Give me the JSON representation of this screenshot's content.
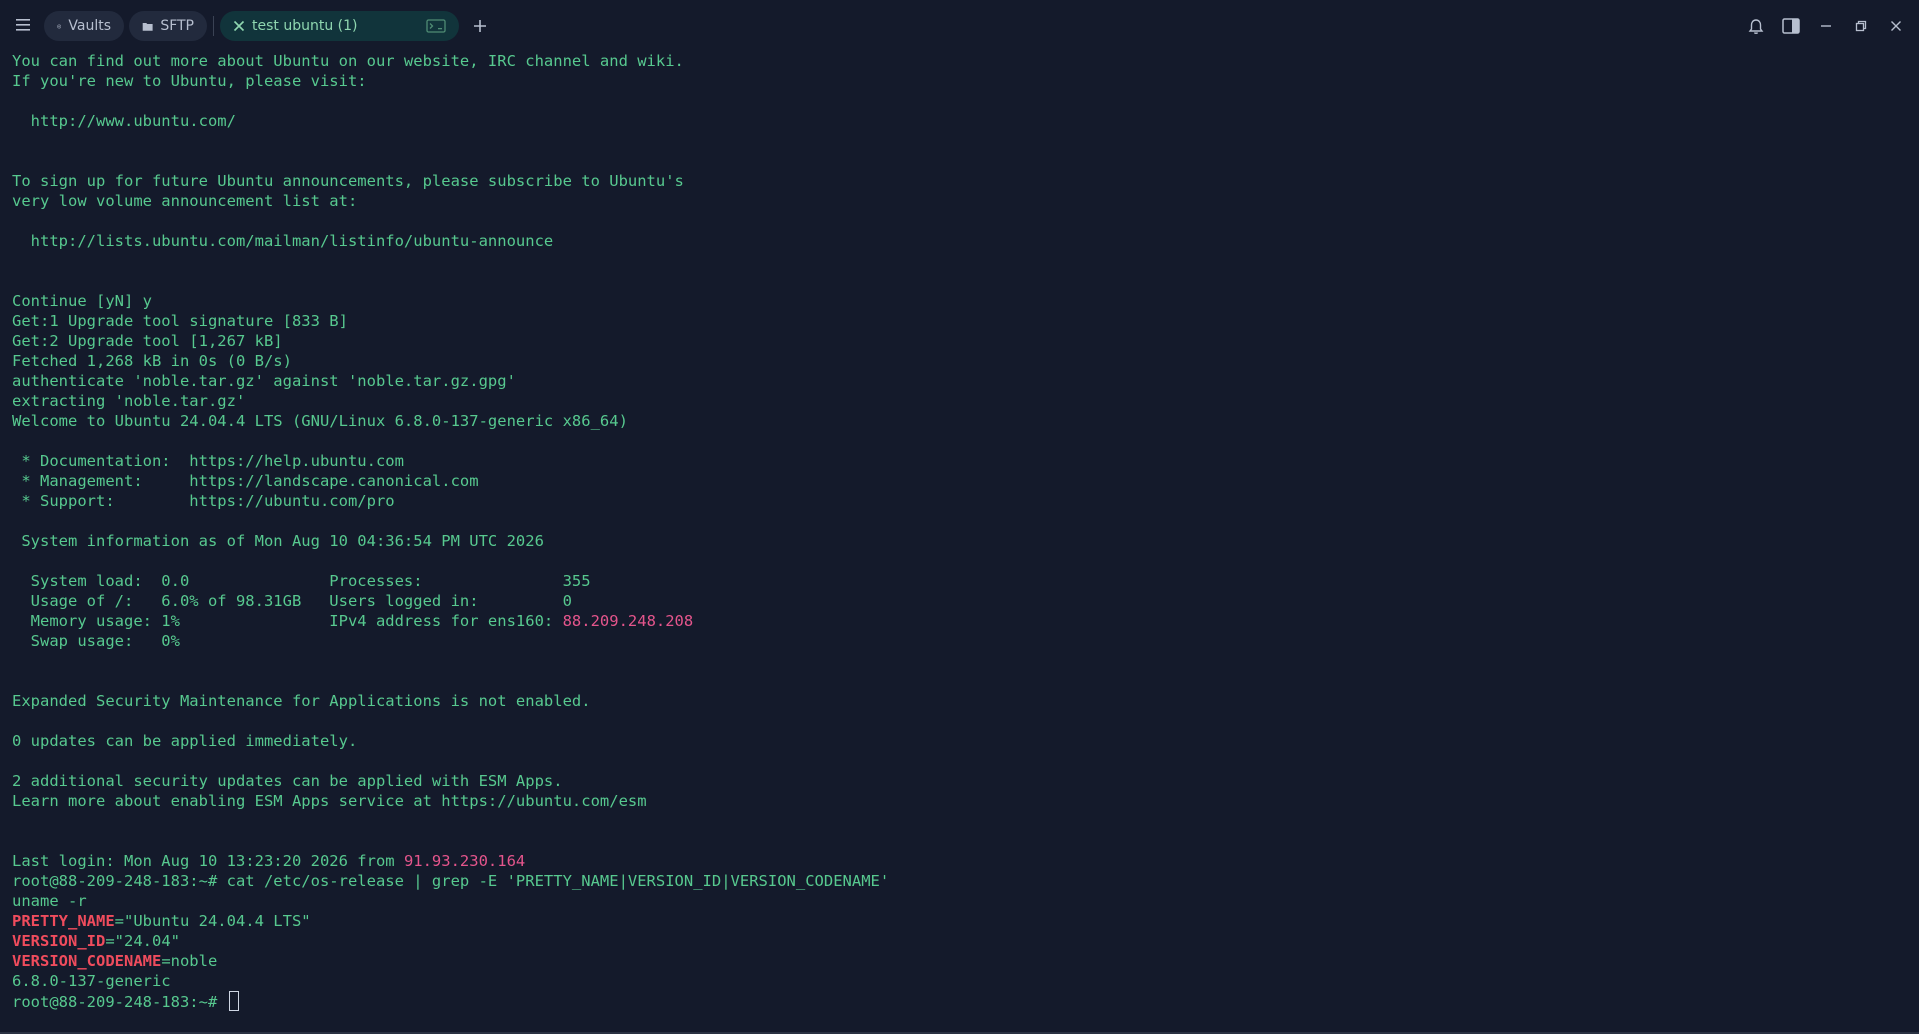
{
  "titlebar": {
    "tabs": [
      {
        "label": "Vaults",
        "icon": "vault-icon"
      },
      {
        "label": "SFTP",
        "icon": "folder-icon"
      },
      {
        "label": "test ubuntu (1)",
        "icon": "close-icon",
        "active": true
      }
    ],
    "icons": [
      "menu-icon",
      "new-tab-icon",
      "bell-icon",
      "sidebar-toggle-icon",
      "minimize-icon",
      "restore-icon",
      "close-window-icon"
    ]
  },
  "colors": {
    "background": "#141a2b",
    "terminal_text": "#57c98f",
    "highlight_ip": "#e5558c",
    "grep_match": "#ef4c5d",
    "active_tab": "#11343b"
  },
  "terminal": {
    "lines": [
      {
        "segments": [
          {
            "text": "You can find out more about Ubuntu on our website, IRC channel and wiki."
          }
        ]
      },
      {
        "segments": [
          {
            "text": "If you're new to Ubuntu, please visit:"
          }
        ]
      },
      {
        "segments": [
          {
            "text": ""
          }
        ]
      },
      {
        "segments": [
          {
            "text": "  http://www.ubuntu.com/"
          }
        ]
      },
      {
        "segments": [
          {
            "text": ""
          }
        ]
      },
      {
        "segments": [
          {
            "text": ""
          }
        ]
      },
      {
        "segments": [
          {
            "text": "To sign up for future Ubuntu announcements, please subscribe to Ubuntu's"
          }
        ]
      },
      {
        "segments": [
          {
            "text": "very low volume announcement list at:"
          }
        ]
      },
      {
        "segments": [
          {
            "text": ""
          }
        ]
      },
      {
        "segments": [
          {
            "text": "  http://lists.ubuntu.com/mailman/listinfo/ubuntu-announce"
          }
        ]
      },
      {
        "segments": [
          {
            "text": ""
          }
        ]
      },
      {
        "segments": [
          {
            "text": ""
          }
        ]
      },
      {
        "segments": [
          {
            "text": "Continue [yN] y"
          }
        ]
      },
      {
        "segments": [
          {
            "text": "Get:1 Upgrade tool signature [833 B]"
          }
        ]
      },
      {
        "segments": [
          {
            "text": "Get:2 Upgrade tool [1,267 kB]"
          }
        ]
      },
      {
        "segments": [
          {
            "text": "Fetched 1,268 kB in 0s (0 B/s)"
          }
        ]
      },
      {
        "segments": [
          {
            "text": "authenticate 'noble.tar.gz' against 'noble.tar.gz.gpg'"
          }
        ]
      },
      {
        "segments": [
          {
            "text": "extracting 'noble.tar.gz'"
          }
        ]
      },
      {
        "segments": [
          {
            "text": "Welcome to Ubuntu 24.04.4 LTS (GNU/Linux 6.8.0-137-generic x86_64)"
          }
        ]
      },
      {
        "segments": [
          {
            "text": ""
          }
        ]
      },
      {
        "segments": [
          {
            "text": " * Documentation:  https://help.ubuntu.com"
          }
        ]
      },
      {
        "segments": [
          {
            "text": " * Management:     https://landscape.canonical.com"
          }
        ]
      },
      {
        "segments": [
          {
            "text": " * Support:        https://ubuntu.com/pro"
          }
        ]
      },
      {
        "segments": [
          {
            "text": ""
          }
        ]
      },
      {
        "segments": [
          {
            "text": " System information as of Mon Aug 10 04:36:54 PM UTC 2026"
          }
        ]
      },
      {
        "segments": [
          {
            "text": ""
          }
        ]
      },
      {
        "segments": [
          {
            "text": "  System load:  0.0               Processes:               355"
          }
        ]
      },
      {
        "segments": [
          {
            "text": "  Usage of /:   6.0% of 98.31GB   Users logged in:         0"
          }
        ]
      },
      {
        "segments": [
          {
            "text": "  Memory usage: 1%                IPv4 address for ens160: "
          },
          {
            "text": "88.209.248.208",
            "style": "hl"
          }
        ]
      },
      {
        "segments": [
          {
            "text": "  Swap usage:   0%"
          }
        ]
      },
      {
        "segments": [
          {
            "text": ""
          }
        ]
      },
      {
        "segments": [
          {
            "text": ""
          }
        ]
      },
      {
        "segments": [
          {
            "text": "Expanded Security Maintenance for Applications is not enabled."
          }
        ]
      },
      {
        "segments": [
          {
            "text": ""
          }
        ]
      },
      {
        "segments": [
          {
            "text": "0 updates can be applied immediately."
          }
        ]
      },
      {
        "segments": [
          {
            "text": ""
          }
        ]
      },
      {
        "segments": [
          {
            "text": "2 additional security updates can be applied with ESM Apps."
          }
        ]
      },
      {
        "segments": [
          {
            "text": "Learn more about enabling ESM Apps service at https://ubuntu.com/esm"
          }
        ]
      },
      {
        "segments": [
          {
            "text": ""
          }
        ]
      },
      {
        "segments": [
          {
            "text": ""
          }
        ]
      },
      {
        "segments": [
          {
            "text": "Last login: Mon Aug 10 13:23:20 2026 from "
          },
          {
            "text": "91.93.230.164",
            "style": "hl"
          }
        ]
      },
      {
        "segments": [
          {
            "text": "root@88-209-248-183:~# cat /etc/os-release | grep -E 'PRETTY_NAME|VERSION_ID|VERSION_CODENAME'"
          }
        ]
      },
      {
        "segments": [
          {
            "text": "uname -r"
          }
        ]
      },
      {
        "segments": [
          {
            "text": "PRETTY_NAME",
            "style": "red"
          },
          {
            "text": "=\"Ubuntu 24.04.4 LTS\""
          }
        ]
      },
      {
        "segments": [
          {
            "text": "VERSION_ID",
            "style": "red"
          },
          {
            "text": "=\"24.04\""
          }
        ]
      },
      {
        "segments": [
          {
            "text": "VERSION_CODENAME",
            "style": "red"
          },
          {
            "text": "=noble"
          }
        ]
      },
      {
        "segments": [
          {
            "text": "6.8.0-137-generic"
          }
        ]
      },
      {
        "segments": [
          {
            "text": "root@88-209-248-183:~# "
          }
        ],
        "cursor": true
      }
    ]
  }
}
